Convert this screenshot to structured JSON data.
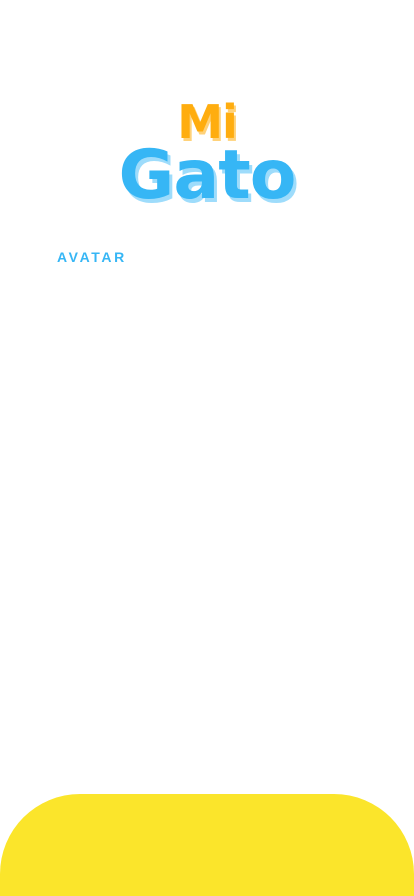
{
  "logo": {
    "line1": "Mi",
    "line2": "Gato"
  },
  "section": {
    "label": "AVATAR"
  },
  "colors": {
    "orange": "#ffad0f",
    "blue": "#36b6f5",
    "yellow": "#fbe52b",
    "background": "#ffffff"
  }
}
